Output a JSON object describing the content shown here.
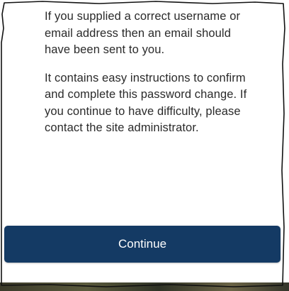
{
  "message": {
    "paragraph_1": "If you supplied a correct username or email address then an email should have been sent to you.",
    "paragraph_2": "It contains easy instructions to confirm and complete this password change. If you continue to have difficulty, please contact the site administrator."
  },
  "actions": {
    "continue_label": "Continue"
  },
  "colors": {
    "button_background": "#143a64",
    "button_text": "#ffffff",
    "body_text": "#2a2a2a",
    "page_background": "#ffffff"
  }
}
